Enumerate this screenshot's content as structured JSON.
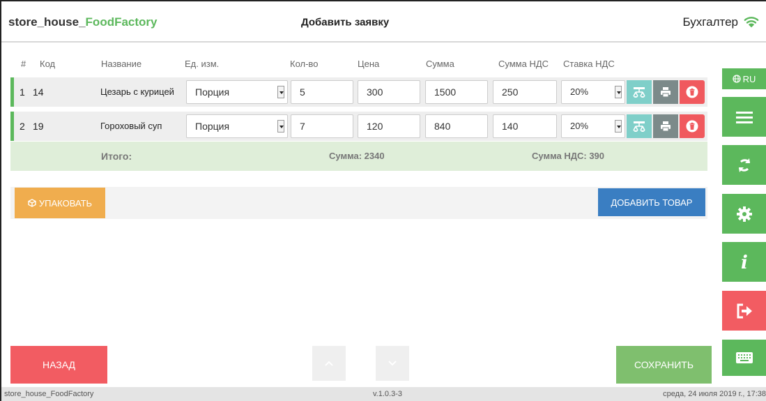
{
  "header": {
    "brand_main": "store_house_",
    "brand_accent": "FoodFactory",
    "title": "Добавить заявку",
    "user": "Бухгалтер",
    "wifi_icon": "wifi-icon"
  },
  "columns": [
    "#",
    "Код",
    "Название",
    "Ед. изм.",
    "Кол-во",
    "Цена",
    "Сумма",
    "Сумма НДС",
    "Ставка НДС"
  ],
  "rows": [
    {
      "num": "1",
      "code": "14",
      "name": "Цезарь с курицей",
      "unit": "Порция",
      "qty": "5",
      "price": "300",
      "sum": "1500",
      "vat_sum": "250",
      "vat_rate": "20%"
    },
    {
      "num": "2",
      "code": "19",
      "name": "Гороховый суп",
      "unit": "Порция",
      "qty": "7",
      "price": "120",
      "sum": "840",
      "vat_sum": "140",
      "vat_rate": "20%"
    }
  ],
  "total": {
    "label": "Итого:",
    "sum": "Сумма: 2340",
    "vat": "Сумма НДС: 390"
  },
  "actions": {
    "pack": "УПАКОВАТЬ",
    "add": "ДОБАВИТЬ ТОВАР"
  },
  "bottom": {
    "back": "НАЗАД",
    "save": "СОХРАНИТЬ"
  },
  "sidebar": {
    "lang": "RU",
    "icons": [
      "menu-icon",
      "sync-icon",
      "settings-icon",
      "info-icon",
      "logout-icon",
      "keyboard-icon"
    ]
  },
  "footer": {
    "left": "store_house_FoodFactory",
    "center": "v.1.0.3-3",
    "right": "среда, 24 июля 2019 г., 17:38"
  },
  "colors": {
    "green": "#5cb85c",
    "red": "#f25c62",
    "orange": "#f0ad4e",
    "blue": "#3a7ec2",
    "teal": "#7fcfc9"
  }
}
